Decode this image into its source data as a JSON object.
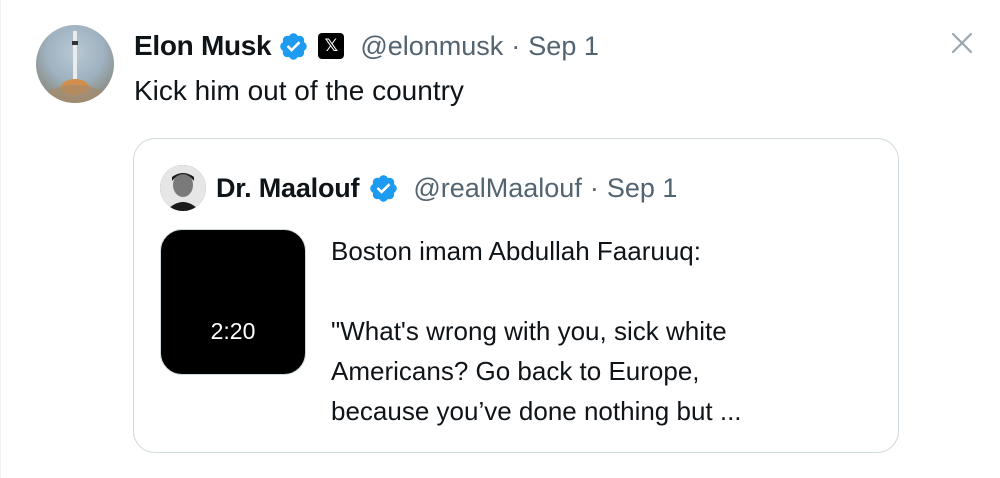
{
  "tweet": {
    "author": {
      "display_name": "Elon Musk",
      "handle": "@elonmusk",
      "verified_icon": "verified-badge-icon",
      "affiliate_badge": "𝕏"
    },
    "separator": "·",
    "date": "Sep 1",
    "text": "Kick him out of the country"
  },
  "quoted_tweet": {
    "author": {
      "display_name": "Dr. Maalouf",
      "handle": "@realMaalouf",
      "verified_icon": "verified-badge-icon"
    },
    "separator": "·",
    "date": "Sep 1",
    "media": {
      "type": "video",
      "duration": "2:20"
    },
    "text_lines": [
      "Boston imam Abdullah Faaruuq:",
      "",
      "\"What's wrong with you, sick white",
      "Americans? Go back to Europe,",
      "because you’ve done nothing but ..."
    ]
  },
  "colors": {
    "text_primary": "#0f1419",
    "text_secondary": "#536471",
    "verified_blue": "#1d9bf0",
    "border": "#cfd9de"
  }
}
